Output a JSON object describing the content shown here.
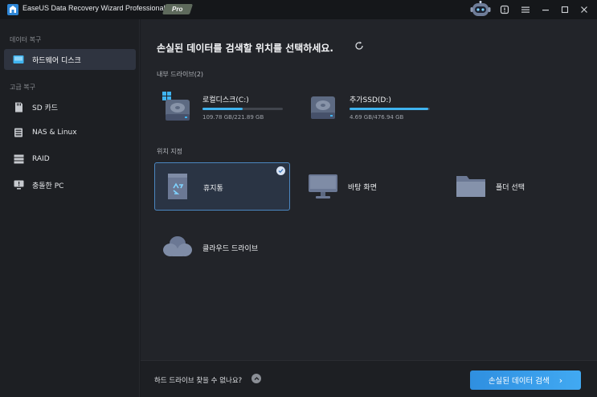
{
  "titlebar": {
    "app_title": "EaseUS Data Recovery Wizard Professional",
    "badge": "Pro",
    "icons": [
      "robot-assistant-icon",
      "notification-icon",
      "menu-icon",
      "minimize-icon",
      "maximize-icon",
      "close-icon"
    ]
  },
  "sidebar": {
    "section_data_recovery": "데이터 복구",
    "item_hard_disk": "하드웨어 디스크",
    "section_advanced": "고급 복구",
    "item_sd": "SD 카드",
    "item_nas": "NAS & Linux",
    "item_raid": "RAID",
    "item_crashed_pc": "충돌한 PC"
  },
  "main": {
    "title": "손실된 데이터를 검색할 위치를 선택하세요.",
    "internal_drives_label": "내부 드라이브(2)",
    "drives": [
      {
        "name": "로컬디스크(C:)",
        "size": "109.78 GB/221.89 GB",
        "used_fraction": 0.495
      },
      {
        "name": "추가SSD(D:)",
        "size": "4.69 GB/476.94 GB",
        "used_fraction": 0.98
      }
    ],
    "location_label": "위치 지정",
    "locations": {
      "recycle_bin": "휴지통",
      "desktop": "바탕 화면",
      "folder": "폴더 선택",
      "cloud": "클라우드 드라이브"
    }
  },
  "footer": {
    "question": "하드 드라이브 찾을 수 없나요?",
    "scan_button": "손실된 데이터 검색"
  },
  "colors": {
    "accent": "#3fb3ef",
    "button": "#2f8fe0",
    "selected_border": "#4b86c0"
  }
}
